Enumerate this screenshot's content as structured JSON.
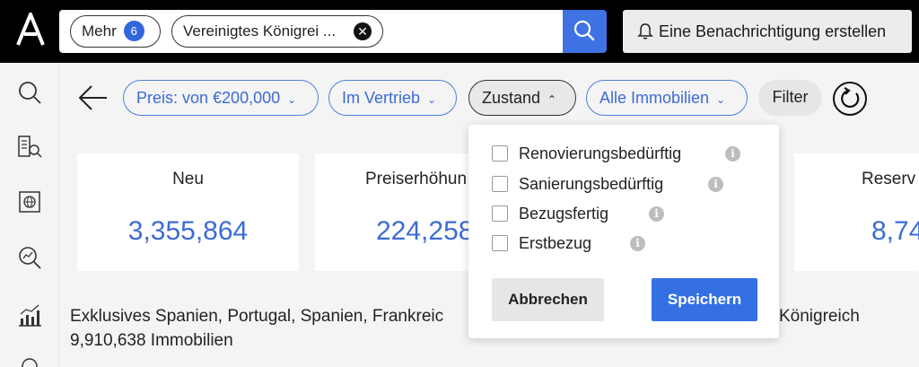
{
  "header": {
    "logo_icon": "a-logo-icon",
    "search_chips": [
      {
        "label": "Mehr",
        "count": "6"
      },
      {
        "label": "Vereinigtes Königrei ..."
      }
    ],
    "alert_button_label": "Eine Benachrichtigung erstellen"
  },
  "filters": {
    "preis": "Preis: von €200,000",
    "vertrieb": "Im Vertrieb",
    "zustand": "Zustand",
    "immobilien": "Alle Immobilien",
    "filter": "Filter"
  },
  "stats": [
    {
      "label": "Neu",
      "value": "3,355,864"
    },
    {
      "label": "Preiserhöhun",
      "value": "224,258"
    },
    {
      "label": "Reserv",
      "value": "8,74"
    }
  ],
  "results": {
    "title": "Exklusives Spanien, Portugal, Spanien, Frankreic",
    "title_tail": "Königreich",
    "count": "9,910,638 Immobilien"
  },
  "zustand_dropdown": {
    "options": [
      {
        "label": "Renovierungsbedürftig",
        "checked": false
      },
      {
        "label": "Sanierungsbedürftig",
        "checked": false
      },
      {
        "label": "Bezugsfertig",
        "checked": false
      },
      {
        "label": "Erstbezug",
        "checked": false
      }
    ],
    "cancel_label": "Abbrechen",
    "save_label": "Speichern"
  },
  "colors": {
    "accent": "#3f73e3",
    "value_blue": "#3c6bd4",
    "topbar": "#000000"
  }
}
